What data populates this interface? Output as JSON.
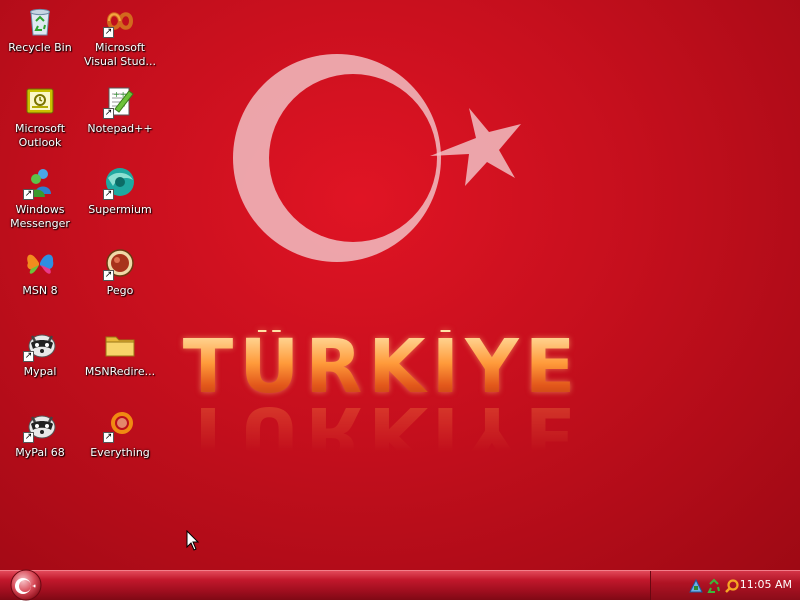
{
  "wallpaper": {
    "title": "TÜRKİYE",
    "colors": {
      "background": "#c50f1d",
      "emblem": "#f2c4c8",
      "title_gradient_top": "#ffe3a8",
      "title_gradient_bottom": "#b83a12"
    }
  },
  "desktop_icons": [
    {
      "label": "Recycle Bin",
      "icon": "recycle-bin-icon",
      "shortcut": false
    },
    {
      "label": "Microsoft Visual Stud...",
      "icon": "visual-studio-icon",
      "shortcut": true
    },
    {
      "label": "Microsoft Outlook",
      "icon": "outlook-icon",
      "shortcut": false
    },
    {
      "label": "Notepad++",
      "icon": "notepad-plus-plus-icon",
      "shortcut": true
    },
    {
      "label": "Windows Messenger",
      "icon": "windows-messenger-icon",
      "shortcut": false
    },
    {
      "label": "Supermium",
      "icon": "supermium-icon",
      "shortcut": true
    },
    {
      "label": "MSN 8",
      "icon": "msn-butterfly-icon",
      "shortcut": false
    },
    {
      "label": "Pego",
      "icon": "pego-icon",
      "shortcut": true
    },
    {
      "label": "Mypal",
      "icon": "mypal-raccoon-icon",
      "shortcut": true
    },
    {
      "label": "MSNRedire...",
      "icon": "folder-icon",
      "shortcut": false
    },
    {
      "label": "MyPal 68",
      "icon": "mypal-raccoon-icon",
      "shortcut": true
    },
    {
      "label": "Everything",
      "icon": "everything-search-icon",
      "shortcut": true
    }
  ],
  "taskbar": {
    "start_icon": "crescent-star-start-icon",
    "tray_icons": [
      "keyboard-icon",
      "network-icon",
      "recycle-tray-icon",
      "search-tray-icon"
    ],
    "clock": "11:05 AM",
    "colors": {
      "bar": "#b01324",
      "tray": "#8a0c19"
    }
  }
}
